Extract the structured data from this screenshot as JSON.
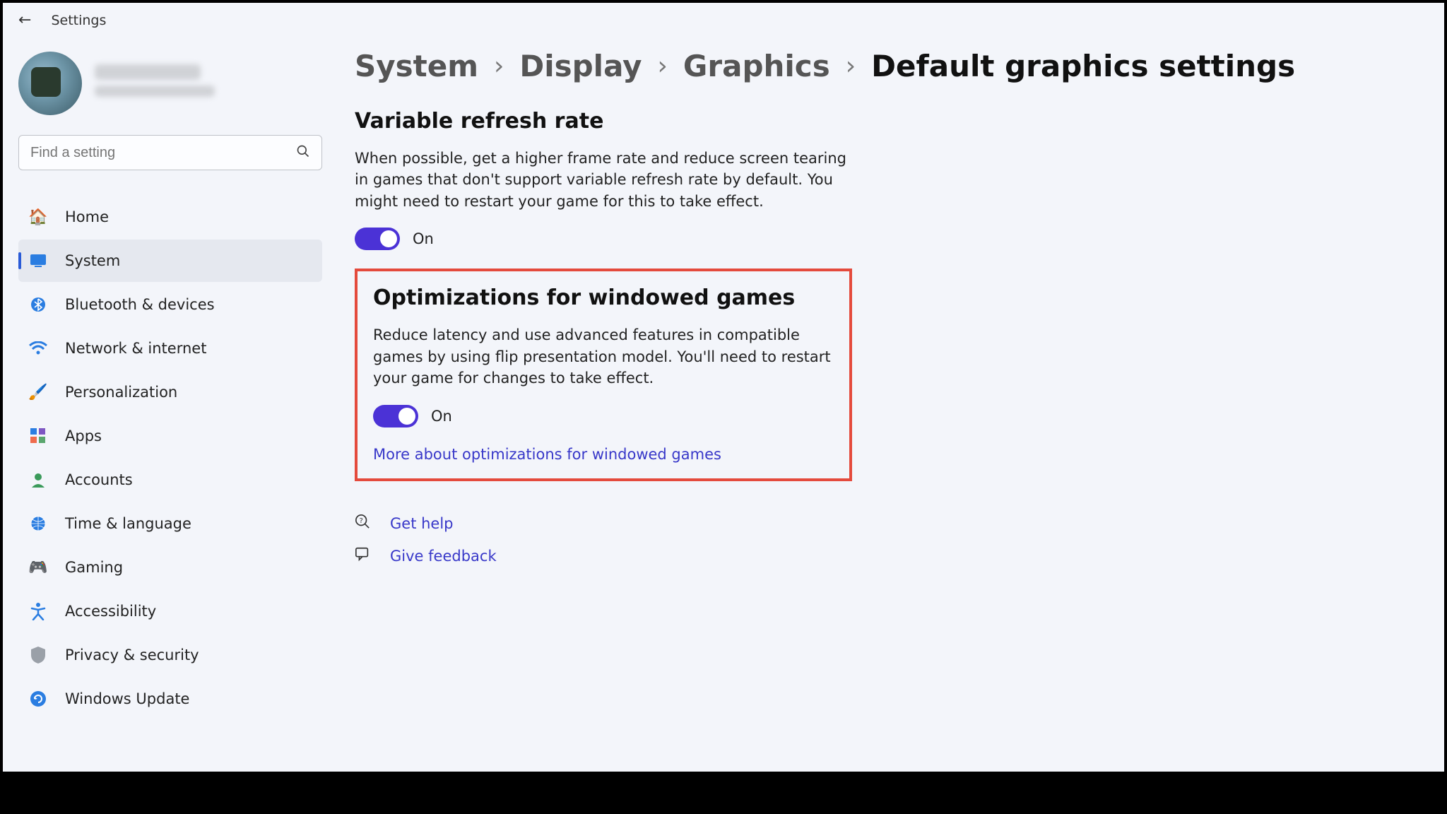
{
  "titlebar": {
    "title": "Settings"
  },
  "search": {
    "placeholder": "Find a setting"
  },
  "nav": {
    "items": [
      {
        "label": "Home"
      },
      {
        "label": "System"
      },
      {
        "label": "Bluetooth & devices"
      },
      {
        "label": "Network & internet"
      },
      {
        "label": "Personalization"
      },
      {
        "label": "Apps"
      },
      {
        "label": "Accounts"
      },
      {
        "label": "Time & language"
      },
      {
        "label": "Gaming"
      },
      {
        "label": "Accessibility"
      },
      {
        "label": "Privacy & security"
      },
      {
        "label": "Windows Update"
      }
    ]
  },
  "breadcrumb": {
    "p0": "System",
    "p1": "Display",
    "p2": "Graphics",
    "current": "Default graphics settings"
  },
  "section_vrr": {
    "title": "Variable refresh rate",
    "desc": "When possible, get a higher frame rate and reduce screen tearing in games that don't support variable refresh rate by default. You might need to restart your game for this to take effect.",
    "toggle_label": "On"
  },
  "section_owg": {
    "title": "Optimizations for windowed games",
    "desc": "Reduce latency and use advanced features in compatible games by using flip presentation model. You'll need to restart your game for changes to take effect.",
    "toggle_label": "On",
    "link": "More about optimizations for windowed games"
  },
  "help": {
    "get_help": "Get help",
    "give_feedback": "Give feedback"
  }
}
